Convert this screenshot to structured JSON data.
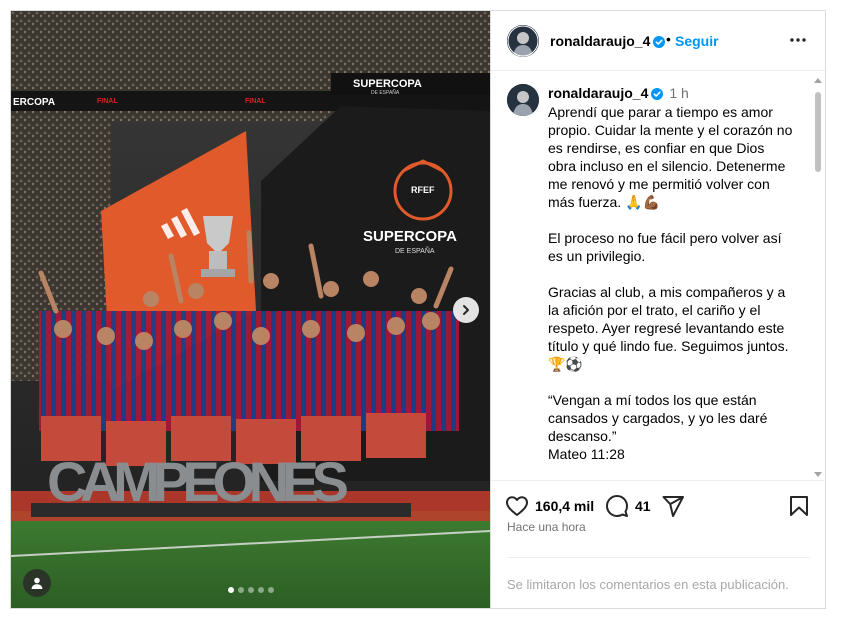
{
  "media": {
    "sign_banner": "SUPERCOPA",
    "sign_banner_sub": "DE ESPAÑA",
    "screen_title": "SUPERCOPA",
    "screen_sub": "DE ESPAÑA",
    "screen_logo": "RFEF",
    "ribbon_left": "ERCOPA",
    "ribbon_final": "FINAL",
    "ribbon_final_sub": "FINAL",
    "sign_letters": "CAMPEONES",
    "carousel_count": 5,
    "carousel_active_index": 0
  },
  "header": {
    "username": "ronaldaraujo_4",
    "separator": "•",
    "follow_label": "Seguir"
  },
  "caption": {
    "username": "ronaldaraujo_4",
    "time": "1 h",
    "paragraphs": [
      "Aprendí que parar a tiempo es amor propio. Cuidar la mente y el corazón no es rendirse, es confiar en que Dios obra incluso en el silencio. Detenerme me renovó y me permitió volver con más fuerza. 🙏💪🏾",
      "El proceso no fue fácil pero volver así es un privilegio.",
      "Gracias al club, a mis compañeros y a la afición por el trato, el cariño y el respeto. Ayer regresé levantando este título y qué lindo fue. Seguimos juntos. 🏆⚽",
      "“Vengan a mí todos los que están cansados y cargados, y yo les daré descanso.”\nMateo 11:28"
    ]
  },
  "actions": {
    "likes": "160,4 mil",
    "comments": "41"
  },
  "time_ago": "Hace una hora",
  "comments_limited": "Se limitaron los comentarios en esta publicación.",
  "colors": {
    "accent": "#0095f6",
    "verified": "#0095f6",
    "muted": "#737373",
    "blaugrana_blue": "#1d3d8c",
    "blaugrana_red": "#a6173a",
    "screen_orange": "#e05a2b"
  },
  "icons": [
    "verified-badge-icon",
    "more-options-icon",
    "heart-icon",
    "comment-icon",
    "share-icon",
    "bookmark-icon",
    "chevron-right-icon",
    "user-tag-icon"
  ]
}
